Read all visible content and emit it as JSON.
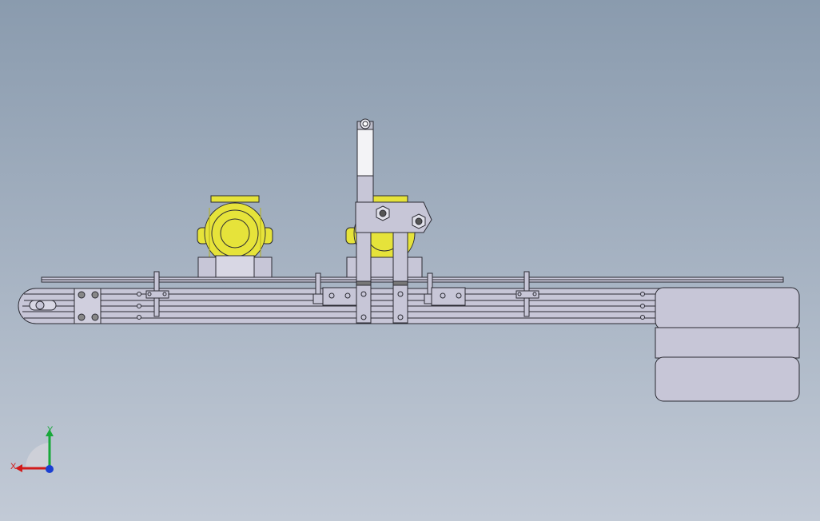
{
  "view": {
    "background_top": "#8a9bae",
    "background_bottom": "#c2cad6",
    "part_color": "#c7c6d7",
    "part_outline": "#2b2b33",
    "motor_color": "#e6e33a",
    "motor_dark": "#b7b21a"
  },
  "triad": {
    "x_label": "X",
    "y_label": "Y",
    "x_color": "#d21a1a",
    "y_color": "#18a83a",
    "z_color": "#1a3fd2"
  }
}
